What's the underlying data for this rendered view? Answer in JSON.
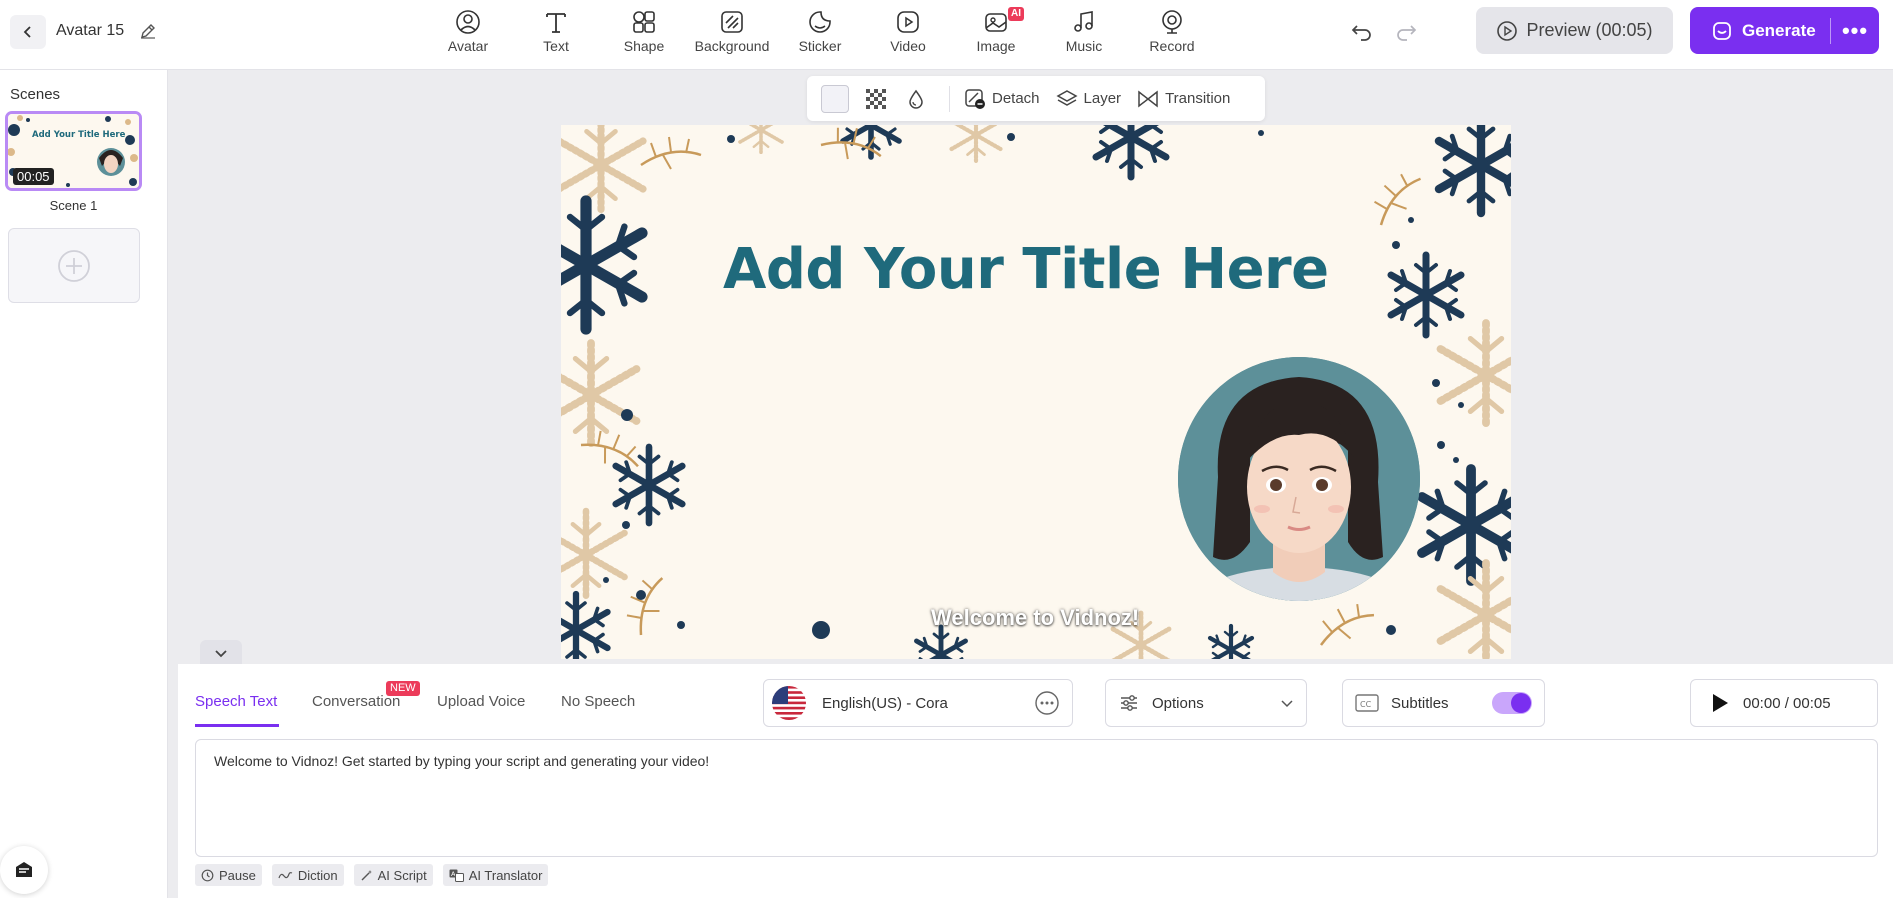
{
  "header": {
    "project_title": "Avatar 15",
    "tools": [
      {
        "label": "Avatar",
        "icon": "avatar-icon"
      },
      {
        "label": "Text",
        "icon": "text-icon"
      },
      {
        "label": "Shape",
        "icon": "shape-icon"
      },
      {
        "label": "Background",
        "icon": "background-icon"
      },
      {
        "label": "Sticker",
        "icon": "sticker-icon"
      },
      {
        "label": "Video",
        "icon": "video-icon"
      },
      {
        "label": "Image",
        "icon": "image-icon",
        "badge": "AI"
      },
      {
        "label": "Music",
        "icon": "music-icon"
      },
      {
        "label": "Record",
        "icon": "record-icon"
      }
    ],
    "preview_label": "Preview (00:05)",
    "generate_label": "Generate",
    "more_label": "•••"
  },
  "sidebar": {
    "heading": "Scenes",
    "scenes": [
      {
        "name": "Scene 1",
        "duration": "00:05",
        "thumb_title": "Add Your Title Here"
      }
    ]
  },
  "canvas_toolbar": {
    "detach_label": "Detach",
    "layer_label": "Layer",
    "transition_label": "Transition"
  },
  "slide": {
    "title": "Add Your Title Here",
    "subtitle": "Welcome to Vidnoz!"
  },
  "bottom": {
    "tabs": [
      {
        "label": "Speech Text",
        "active": true
      },
      {
        "label": "Conversation",
        "badge": "NEW"
      },
      {
        "label": "Upload Voice"
      },
      {
        "label": "No Speech"
      }
    ],
    "voice": "English(US) - Cora",
    "options_label": "Options",
    "subtitles_label": "Subtitles",
    "subtitles_on": true,
    "time": "00:00 / 00:05",
    "script": "Welcome to Vidnoz! Get started by typing your script and generating your video!",
    "chips": [
      "Pause",
      "Diction",
      "AI Script",
      "AI Translator"
    ]
  },
  "colors": {
    "accent": "#7a2ff0",
    "title_teal": "#1f6a7c",
    "badge_red": "#ec3b5a",
    "snowflake_navy": "#1e3a56",
    "branch_gold": "#c89a5a"
  }
}
